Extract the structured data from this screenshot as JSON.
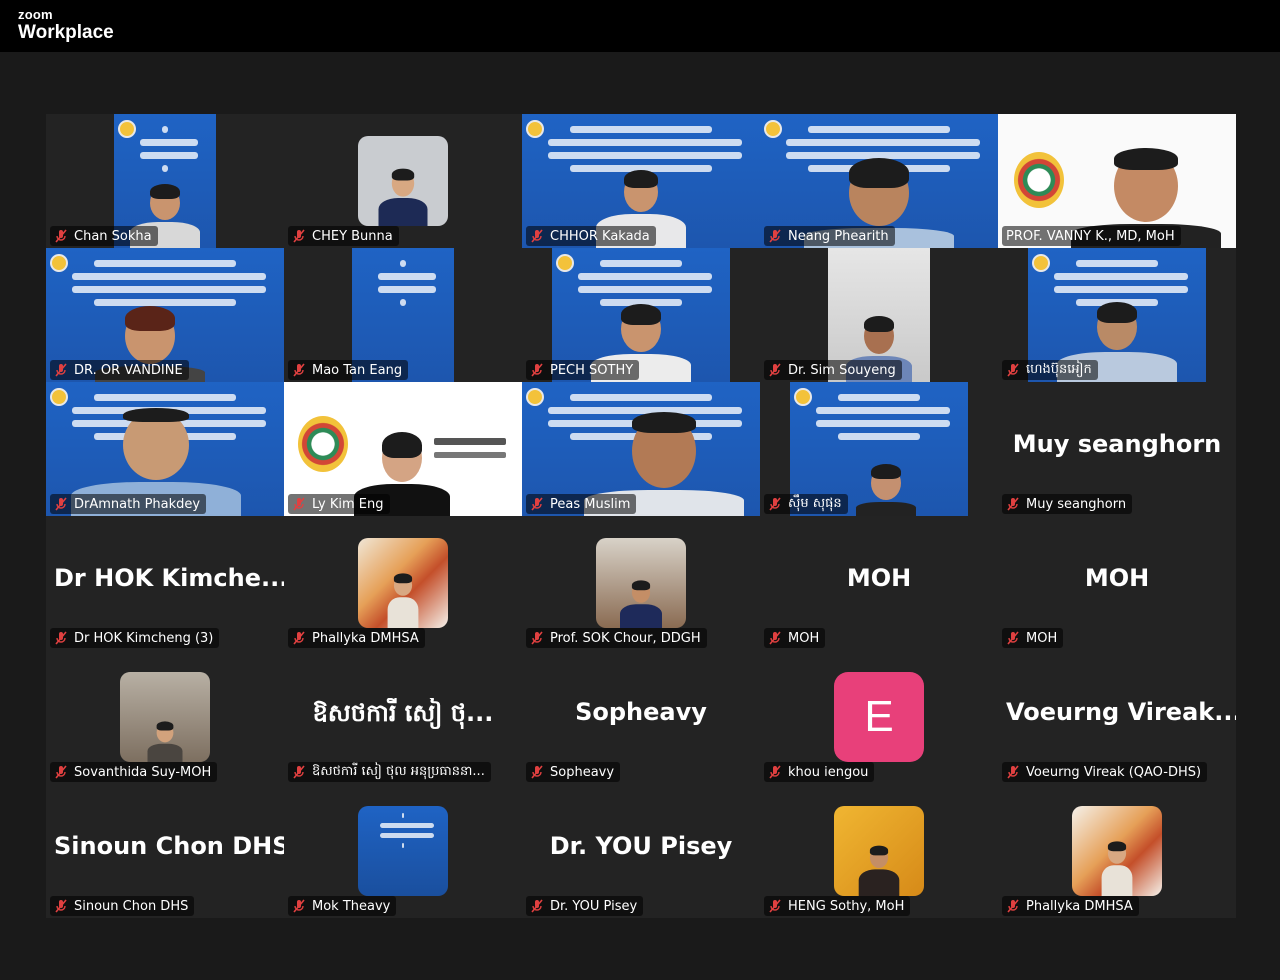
{
  "app": {
    "brand_small": "zoom",
    "brand_big": "Workplace"
  },
  "colors": {
    "active_speaker": "#3ad07a",
    "video_banner_blue": "#1f63c4",
    "avatar_e": "#e8407a",
    "muted_icon": "#e04040"
  },
  "participants": [
    {
      "label": "Chan Sokha",
      "type": "video"
    },
    {
      "label": "CHEY Bunna",
      "type": "photo"
    },
    {
      "label": "CHHOR Kakada",
      "type": "video"
    },
    {
      "label": "Neang Phearith",
      "type": "video"
    },
    {
      "label": "PROF. VANNY K., MD, MoH",
      "type": "video",
      "active": true
    },
    {
      "label": "DR. OR VANDINE",
      "type": "video"
    },
    {
      "label": "Mao Tan Eang",
      "type": "video"
    },
    {
      "label": "PECH SOTHY",
      "type": "video"
    },
    {
      "label": "Dr. Sim Souyeng",
      "type": "video"
    },
    {
      "label": "ហេងប៊ុនអៀក",
      "type": "video"
    },
    {
      "label": "DrAmnath Phakdey",
      "type": "video"
    },
    {
      "label": "Ly Kim Eng",
      "type": "video"
    },
    {
      "label": "Peas Muslim",
      "type": "video"
    },
    {
      "label": "ស៊ឹម សុផុន",
      "type": "video"
    },
    {
      "label": "Muy seanghorn",
      "display": "Muy seanghorn",
      "type": "name"
    },
    {
      "label": "Dr HOK Kimcheng (3)",
      "display": "Dr HOK Kimche...",
      "type": "name"
    },
    {
      "label": "Phallyka DMHSA",
      "type": "photo"
    },
    {
      "label": "Prof. SOK Chour, DDGH",
      "type": "photo"
    },
    {
      "label": "MOH",
      "display": "MOH",
      "type": "name"
    },
    {
      "label": "MOH",
      "display": "MOH",
      "type": "name"
    },
    {
      "label": "Sovanthida Suy-MOH",
      "type": "photo"
    },
    {
      "label": "ឱសថការី សៀ ថុល អនុប្រធាន​នា...",
      "display": "ឱសថការី សៀ ថុ...",
      "type": "name"
    },
    {
      "label": "Sopheavy",
      "display": "Sopheavy",
      "type": "name"
    },
    {
      "label": "khou iengou",
      "avatar_letter": "E",
      "type": "avatar"
    },
    {
      "label": "Voeurng Vireak (QAO-DHS)",
      "display": "Voeurng Vireak...",
      "type": "name"
    },
    {
      "label": "Sinoun Chon DHS",
      "display": "Sinoun Chon DHS",
      "type": "name"
    },
    {
      "label": "Mok Theavy",
      "type": "photo"
    },
    {
      "label": "Dr. YOU Pisey",
      "display": "Dr. YOU Pisey",
      "type": "name"
    },
    {
      "label": "HENG Sothy, MoH",
      "type": "photo"
    },
    {
      "label": "Phallyka DMHSA",
      "type": "photo"
    }
  ]
}
